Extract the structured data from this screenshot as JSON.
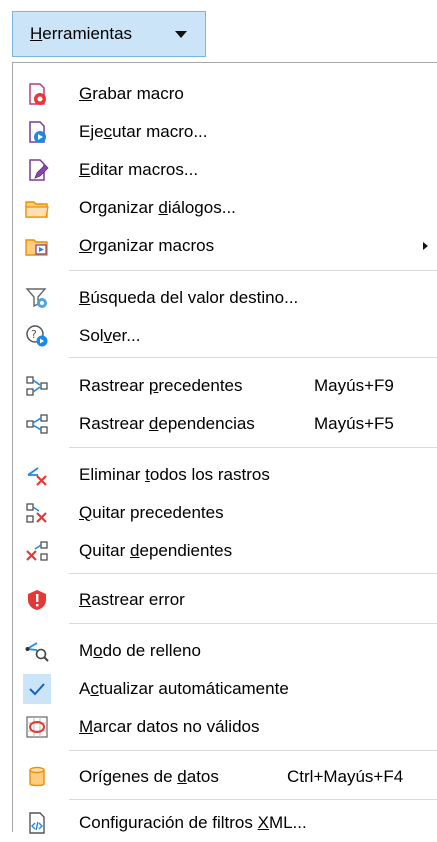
{
  "menu_button": {
    "label_pre": "",
    "label_ul": "H",
    "label_post": "erramientas"
  },
  "items": [
    {
      "pre": "",
      "ul": "G",
      "post": "rabar macro"
    },
    {
      "pre": "Eje",
      "ul": "c",
      "post": "utar macro..."
    },
    {
      "pre": "",
      "ul": "E",
      "post": "ditar macros..."
    },
    {
      "pre": "Organizar ",
      "ul": "d",
      "post": "iálogos..."
    },
    {
      "pre": "",
      "ul": "O",
      "post": "rganizar macros"
    },
    {
      "pre": "",
      "ul": "B",
      "post": "úsqueda del valor destino..."
    },
    {
      "pre": "Sol",
      "ul": "v",
      "post": "er..."
    },
    {
      "pre": "Rastrear ",
      "ul": "p",
      "post": "recedentes",
      "shortcut": "Mayús+F9"
    },
    {
      "pre": "Rastrear ",
      "ul": "d",
      "post": "ependencias",
      "shortcut": "Mayús+F5"
    },
    {
      "pre": "Eliminar ",
      "ul": "t",
      "post": "odos los rastros"
    },
    {
      "pre": "",
      "ul": "Q",
      "post": "uitar precedentes"
    },
    {
      "pre": "Quitar ",
      "ul": "d",
      "post": "ependientes"
    },
    {
      "pre": "",
      "ul": "R",
      "post": "astrear error"
    },
    {
      "pre": "M",
      "ul": "o",
      "post": "do de relleno"
    },
    {
      "pre": "A",
      "ul": "c",
      "post": "tualizar automáticamente"
    },
    {
      "pre": "",
      "ul": "M",
      "post": "arcar datos no válidos"
    },
    {
      "pre": "Orígenes de ",
      "ul": "d",
      "post": "atos",
      "shortcut": "Ctrl+Mayús+F4"
    },
    {
      "pre": "Configuración de filtros ",
      "ul": "X",
      "post": "ML..."
    }
  ],
  "icons": [
    "record-macro-icon",
    "run-macro-icon",
    "edit-macros-icon",
    "organize-dialogs-icon",
    "organize-macros-icon",
    "goal-seek-icon",
    "solver-icon",
    "trace-precedents-icon",
    "trace-dependents-icon",
    "remove-all-traces-icon",
    "remove-precedents-icon",
    "remove-dependents-icon",
    "trace-error-icon",
    "fill-mode-icon",
    "checkmark-icon",
    "invalid-data-icon",
    "data-sources-icon",
    "xml-filter-settings-icon"
  ]
}
